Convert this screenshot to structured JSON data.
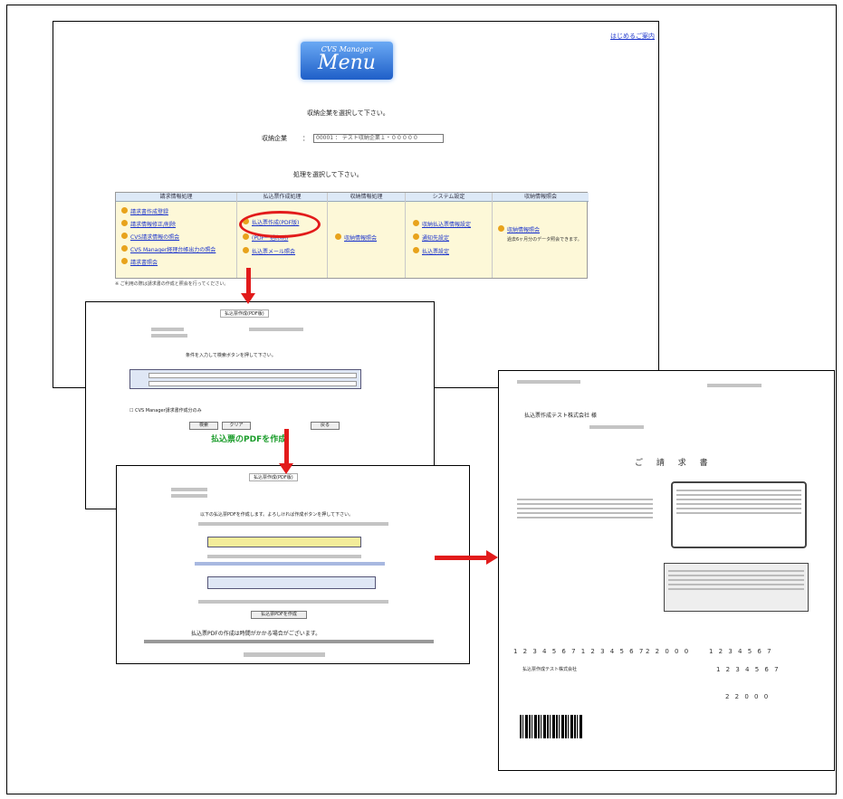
{
  "menu_screen": {
    "help_link": "はじめるご案内",
    "logo_line1": "CVS Manager",
    "logo_line2": "Menu",
    "prompt_company": "収納企業を選択して下さい。",
    "company_label": "収納企業",
    "company_value": "00001 ： テスト収納企業１・０００００",
    "prompt_process": "処理を選択して下さい。",
    "columns": [
      {
        "header": "請求情報処理",
        "items": [
          "請求書作成登録",
          "請求情報修正/削除",
          "CVS請求情報の照会",
          "CVS Manager経理台帳出力の照会",
          "請求書照会"
        ]
      },
      {
        "header": "払込票作成処理",
        "items": [
          "払込票作成(PDF版)",
          "(PDF一括印刷)",
          "払込票メール照会"
        ]
      },
      {
        "header": "収納情報処理",
        "items": [
          "収納情報照会"
        ]
      },
      {
        "header": "システム設定",
        "items": [
          "収納払込票情報設定",
          "通知先設定",
          "払込票設定"
        ]
      },
      {
        "header": "収納情報照会",
        "items": [
          "収納情報照会",
          "過去6ヶ月分のデータ照会できます。"
        ]
      }
    ],
    "footnote": "※ ご利用の際は請求書の作成と照会を行ってください。"
  },
  "form_screen": {
    "title": "払込票作成(PDF版)",
    "instruction": "条件を入力して検索ボタンを押して下さい。",
    "checkbox_label": "CVS Manager請求書作成分のみ",
    "buttons": [
      "検索",
      "クリア",
      "戻る"
    ],
    "green_text": "払込票のPDFを作成"
  },
  "confirm_screen": {
    "title": "払込票作成(PDF版)",
    "instruction": "以下の払込票PDFを作成します。よろしければ作成ボタンを押して下さい。",
    "button": "払込票PDFを作成",
    "red_notice": "払込票PDFの作成は時間がかかる場合がございます。"
  },
  "invoice": {
    "title": "ご 請 求 書",
    "recipient": "払込票作成テスト株式会社 様",
    "numbers": "1 2 3 4 5 6 7  1 2 3 4 5 6 7",
    "amount": "2 2 0 0 0",
    "short_code": "1 2 3 4 5 6 7",
    "company": "払込票作成テスト株式会社"
  },
  "colors": {
    "arrow": "#e21b1b",
    "link": "#1a33cc",
    "menu_bg": "#fdf8d8"
  }
}
